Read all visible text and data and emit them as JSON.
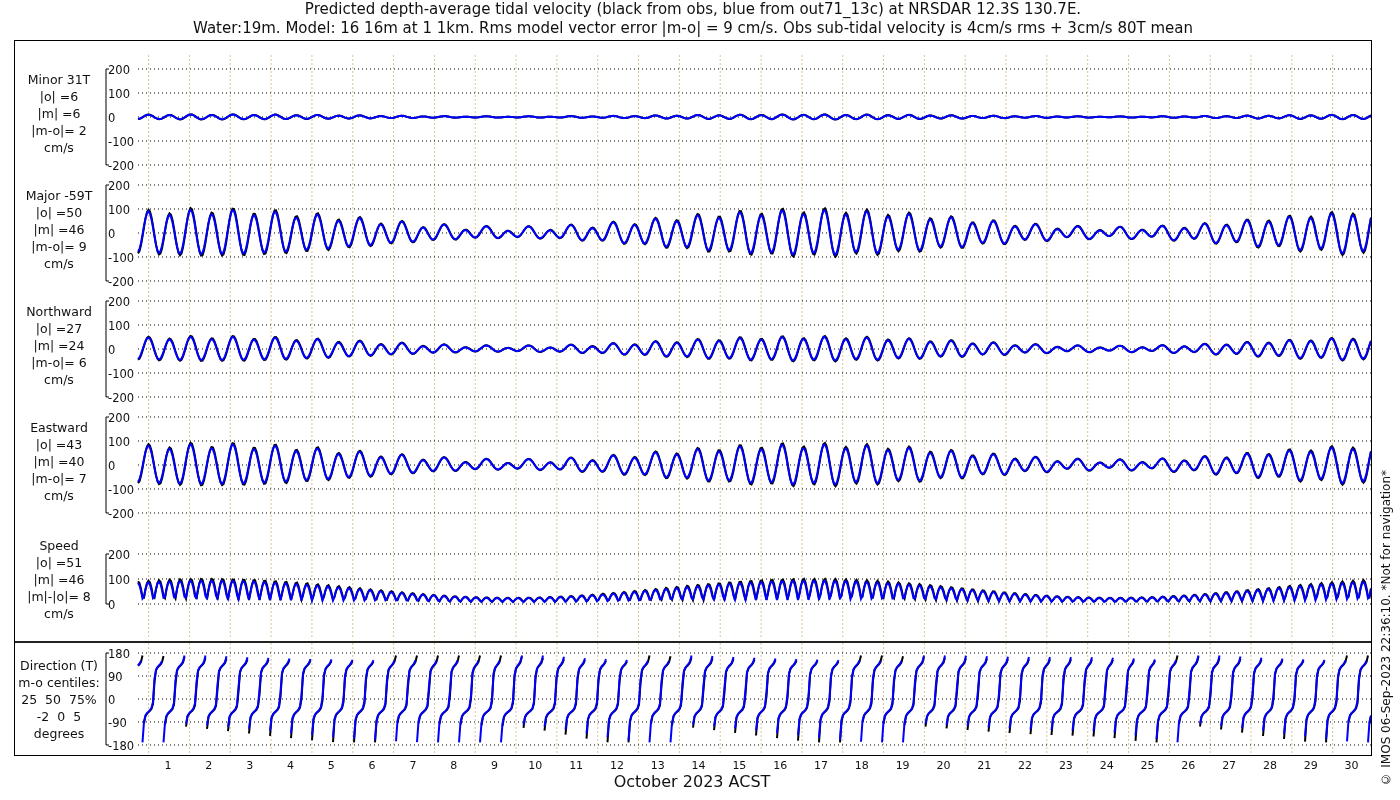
{
  "title_lines": [
    "Predicted depth-average tidal velocity (black from obs, blue from out71_13c) at NRSDAR 12.3S 130.7E.",
    "Water:19m. Model: 16 16m at 1 1km. Rms model vector error |m-o| = 9 cm/s. Obs sub-tidal velocity is 4cm/s rms + 3cm/s 80T mean"
  ],
  "panels": [
    {
      "kind": "velocity",
      "label_lines": [
        "Minor 31T",
        "|o| =6",
        "|m| =6",
        "|m-o|= 2",
        "cm/s"
      ],
      "yticks": [
        "200",
        "100",
        "0",
        "-100",
        "-200"
      ]
    },
    {
      "kind": "velocity",
      "label_lines": [
        "Major -59T",
        "|o| =50",
        "|m| =46",
        "|m-o|= 9",
        "cm/s"
      ],
      "yticks": [
        "200",
        "100",
        "0",
        "-100",
        "-200"
      ]
    },
    {
      "kind": "velocity",
      "label_lines": [
        "Northward",
        "|o| =27",
        "|m| =24",
        "|m-o|= 6",
        "cm/s"
      ],
      "yticks": [
        "200",
        "100",
        "0",
        "-100",
        "-200"
      ]
    },
    {
      "kind": "velocity",
      "label_lines": [
        "Eastward",
        "|o| =43",
        "|m| =40",
        "|m-o|= 7",
        "cm/s"
      ],
      "yticks": [
        "200",
        "100",
        "0",
        "-100",
        "-200"
      ]
    },
    {
      "kind": "speed",
      "label_lines": [
        "Speed",
        "|o| =51",
        "|m| =46",
        "|m|-|o|= 8",
        "cm/s"
      ],
      "yticks": [
        "200",
        "100",
        "0"
      ]
    },
    {
      "kind": "direction",
      "label_lines": [
        "Direction (T)",
        "m-o centiles:",
        "25  50  75%",
        "-2  0  5",
        "degrees"
      ],
      "yticks": [
        "180",
        "90",
        "0",
        "-90",
        "-180"
      ]
    }
  ],
  "x_axis": {
    "ticks": [
      "1",
      "2",
      "3",
      "4",
      "5",
      "6",
      "7",
      "8",
      "9",
      "10",
      "11",
      "12",
      "13",
      "14",
      "15",
      "16",
      "17",
      "18",
      "19",
      "20",
      "21",
      "22",
      "23",
      "24",
      "25",
      "26",
      "27",
      "28",
      "29",
      "30"
    ],
    "label": "October 2023 ACST"
  },
  "side_note": "© IMOS 06-Sep-2023 22:36:10. *Not for navigation*"
}
